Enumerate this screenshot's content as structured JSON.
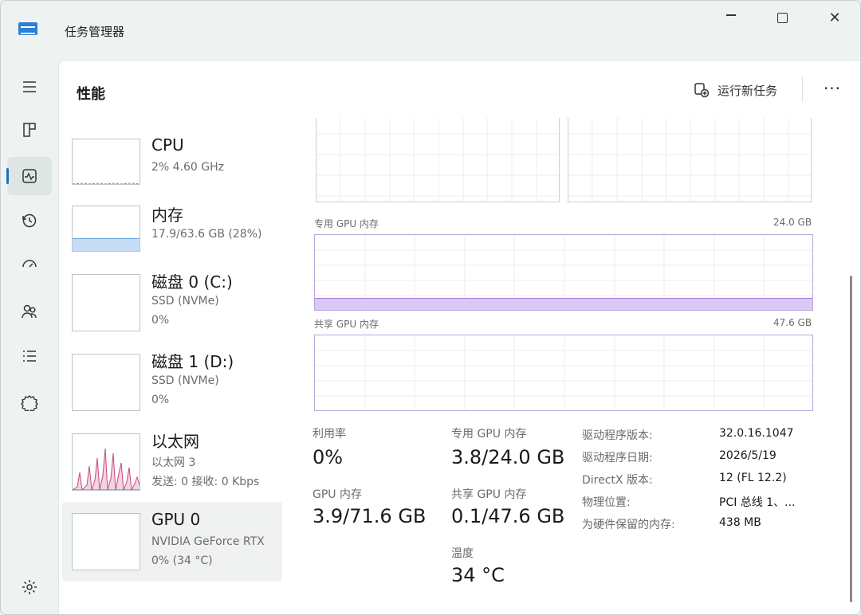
{
  "window": {
    "title": "任务管理器",
    "accent": "#1f6fb8",
    "memory_fill": "#c6ddf6",
    "gpu_mem_fill": "#dcc8f4",
    "ethernet_color": "#c9487c"
  },
  "rail": {
    "items": [
      {
        "icon": "hamburger-menu-icon"
      },
      {
        "icon": "processes-icon"
      },
      {
        "icon": "performance-icon",
        "active": true
      },
      {
        "icon": "app-history-icon"
      },
      {
        "icon": "startup-apps-icon"
      },
      {
        "icon": "users-icon"
      },
      {
        "icon": "details-icon"
      },
      {
        "icon": "services-icon"
      },
      {
        "icon": "settings-icon"
      }
    ]
  },
  "header": {
    "title": "性能",
    "run_task_label": "运行新任务",
    "more_label": "···"
  },
  "devices": [
    {
      "name": "CPU",
      "sub1": "2% 4.60 GHz",
      "sub2": ""
    },
    {
      "name": "内存",
      "sub1": "17.9/63.6 GB (28%)",
      "sub2": "",
      "fill_fraction": 0.28
    },
    {
      "name": "磁盘 0 (C:)",
      "sub1": "SSD (NVMe)",
      "sub2": "0%"
    },
    {
      "name": "磁盘 1 (D:)",
      "sub1": "SSD (NVMe)",
      "sub2": "0%"
    },
    {
      "name": "以太网",
      "sub1": "以太网 3",
      "sub2": "发送: 0 接收: 0 Kbps"
    },
    {
      "name": "GPU 0",
      "sub1": "NVIDIA GeForce RTX",
      "sub2": "0% (34 °C)",
      "selected": true
    }
  ],
  "graphs": {
    "dedicated_label": "专用 GPU 内存",
    "dedicated_max": "24.0 GB",
    "dedicated_fill_fraction": 0.16,
    "shared_label": "共享 GPU 内存",
    "shared_max": "47.6 GB"
  },
  "stats": {
    "utilization_label": "利用率",
    "utilization_value": "0%",
    "gpu_memory_label": "GPU 内存",
    "gpu_memory_value": "3.9/71.6 GB",
    "dedicated_label": "专用 GPU 内存",
    "dedicated_value": "3.8/24.0 GB",
    "shared_label": "共享 GPU 内存",
    "shared_value": "0.1/47.6 GB",
    "temp_label": "温度",
    "temp_value": "34 °C"
  },
  "info": [
    {
      "key": "驱动程序版本:",
      "value": "32.0.16.1047"
    },
    {
      "key": "驱动程序日期:",
      "value": "2026/5/19"
    },
    {
      "key": "DirectX 版本:",
      "value": "12 (FL 12.2)"
    },
    {
      "key": "物理位置:",
      "value": "PCI 总线 1、..."
    },
    {
      "key": "为硬件保留的内存:",
      "value": "438 MB"
    }
  ]
}
